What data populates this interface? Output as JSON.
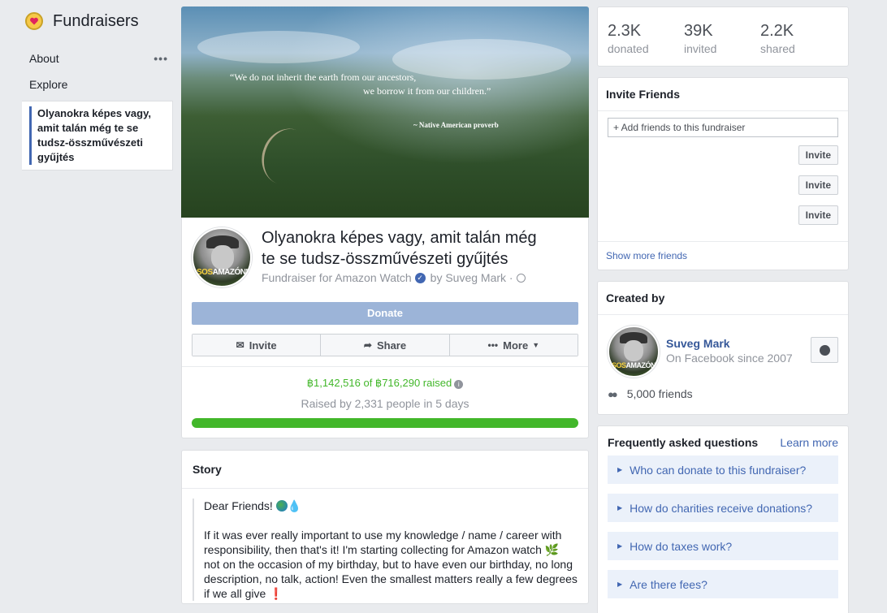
{
  "sidebar": {
    "title": "Fundraisers",
    "about": "About",
    "more_dots": "•••",
    "explore": "Explore",
    "active_item": "Olyanokra képes vagy, amit talán még te se tudsz-összművészeti gyűjtés"
  },
  "hero": {
    "quote_line1": "“We do not inherit the earth from our ancestors,",
    "quote_line2": "we borrow it from our children.”",
    "attribution": "~ Native American proverb"
  },
  "fundraiser": {
    "avatar_text_1": "SOS",
    "avatar_text_2": "AMAZÓNI",
    "title": "Olyanokra képes vagy, amit talán még te se tudsz-összművészeti gyűjtés",
    "for_text": "Fundraiser for Amazon Watch",
    "by_text": "by Suveg Mark ·",
    "donate_label": "Donate",
    "invite_label": "Invite",
    "share_label": "Share",
    "more_label": "More",
    "raised_text": "฿1,142,516 of ฿716,290 raised",
    "raised_by_text": "Raised by 2,331 people in 5 days",
    "progress_fraction": 1.0
  },
  "story": {
    "heading": "Story",
    "greeting": "Dear Friends!",
    "body": "If it was ever really important to use my knowledge / name / career with responsibility, then that's it! I'm starting collecting for Amazon watch",
    "body2": "not on the occasion of my birthday, but to have even our birthday, no long description, no talk, action! Even the smallest matters really a few degrees if we all give",
    "leaf_emoji": "🌿",
    "exclaim_emoji": "❗"
  },
  "stats": [
    {
      "num": "2.3K",
      "label": "donated"
    },
    {
      "num": "39K",
      "label": "invited"
    },
    {
      "num": "2.2K",
      "label": "shared"
    }
  ],
  "invite": {
    "heading": "Invite Friends",
    "placeholder": "+ Add friends to this fundraiser",
    "button_label": "Invite",
    "show_more": "Show more friends"
  },
  "created_by": {
    "heading": "Created by",
    "name": "Suveg Mark",
    "since": "On Facebook since 2007",
    "friends": "5,000 friends"
  },
  "faq": {
    "heading": "Frequently asked questions",
    "learn_more": "Learn more",
    "items": [
      "Who can donate to this fundraiser?",
      "How do charities receive donations?",
      "How do taxes work?",
      "Are there fees?"
    ]
  },
  "colors": {
    "brand_blue": "#4267b2",
    "progress_green": "#42b72a",
    "donate_disabled": "#9cb4d8"
  }
}
